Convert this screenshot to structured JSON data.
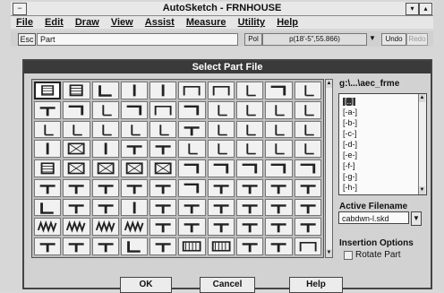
{
  "window": {
    "title": "AutoSketch - FRNHOUSE",
    "system_menu_label": "−",
    "minimize_label": "▾",
    "maximize_label": "▴"
  },
  "menubar": {
    "items": [
      "File",
      "Edit",
      "Draw",
      "View",
      "Assist",
      "Measure",
      "Utility",
      "Help"
    ]
  },
  "commandbar": {
    "esc_label": "Esc",
    "prompt": "Part",
    "pol_label": "Pol",
    "coordinates": "p(18'-5\",55.866)",
    "undo_label": "Undo",
    "redo_label": "Redo"
  },
  "dialog": {
    "title": "Select Part File",
    "directory_label": "g:\\...\\aec_frme",
    "directory_items": [
      "[..]",
      "[-a-]",
      "[-b-]",
      "[-c-]",
      "[-d-]",
      "[-e-]",
      "[-f-]",
      "[-g-]",
      "[-h-]"
    ],
    "active_filename_label": "Active Filename",
    "active_filename_value": "cabdwn-l.skd",
    "insertion_options_label": "Insertion Options",
    "rotate_part_label": "Rotate Part",
    "rotate_part_checked": false,
    "ok_label": "OK",
    "cancel_label": "Cancel",
    "help_label": "Help",
    "part_grid": {
      "rows": 9,
      "cols": 10,
      "selected_index": 0,
      "thumbnail_icons": [
        "cabinet-icon",
        "cabinet-icon",
        "wall-corner-icon",
        "wall-segment-icon",
        "wall-segment-icon",
        "frame-icon",
        "frame-icon",
        "wall-end-icon",
        "corner-icon",
        "wall-end-icon",
        "wall-tee-icon",
        "corner-icon",
        "wall-end-icon",
        "corner-icon",
        "frame-icon",
        "corner-icon",
        "wall-end-icon",
        "wall-end-icon",
        "wall-end-icon",
        "wall-end-icon",
        "wall-end-icon",
        "wall-end-icon",
        "wall-end-icon",
        "wall-end-icon",
        "wall-end-icon",
        "wall-tee-icon",
        "wall-end-icon",
        "wall-end-icon",
        "wall-end-icon",
        "wall-end-icon",
        "wall-segment-icon",
        "cross-box-icon",
        "wall-segment-icon",
        "wall-tee-icon",
        "wall-tee-icon",
        "wall-end-icon",
        "wall-end-icon",
        "wall-end-icon",
        "wall-end-icon",
        "wall-end-icon",
        "cabinet-icon",
        "cross-box-icon",
        "cross-box-icon",
        "cross-box-icon",
        "cross-box-icon",
        "corner-icon",
        "corner-icon",
        "corner-icon",
        "corner-icon",
        "corner-icon",
        "wall-tee-icon",
        "wall-tee-icon",
        "wall-tee-icon",
        "wall-tee-icon",
        "wall-tee-icon",
        "corner-icon",
        "wall-tee-icon",
        "wall-tee-icon",
        "wall-tee-icon",
        "wall-tee-icon",
        "wall-corner-icon",
        "wall-tee-icon",
        "wall-tee-icon",
        "wall-segment-icon",
        "wall-tee-icon",
        "wall-tee-icon",
        "wall-tee-icon",
        "wall-tee-icon",
        "wall-tee-icon",
        "wall-tee-icon",
        "zigzag-icon",
        "zigzag-icon",
        "zigzag-icon",
        "zigzag-icon",
        "wall-tee-icon",
        "wall-tee-icon",
        "wall-tee-icon",
        "wall-tee-icon",
        "wall-tee-icon",
        "wall-tee-icon",
        "wall-tee-icon",
        "wall-tee-icon",
        "wall-tee-icon",
        "wall-corner-icon",
        "wall-tee-icon",
        "hatched-icon",
        "hatched-icon",
        "wall-tee-icon",
        "wall-tee-icon",
        "frame-icon"
      ]
    }
  }
}
